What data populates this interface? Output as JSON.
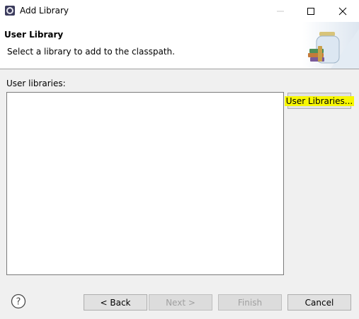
{
  "window": {
    "title": "Add Library"
  },
  "banner": {
    "title": "User Library",
    "description": "Select a library to add to the classpath."
  },
  "main": {
    "list_label": "User libraries:",
    "user_libraries_button": "User Libraries..."
  },
  "footer": {
    "back_label": "< Back",
    "next_label": "Next >",
    "finish_label": "Finish",
    "cancel_label": "Cancel"
  },
  "colors": {
    "highlight": "#f7f700",
    "window_bg": "#f0f0f0"
  },
  "icons": {
    "app": "eclipse-icon",
    "help": "help-icon",
    "banner": "library-jar-icon"
  }
}
